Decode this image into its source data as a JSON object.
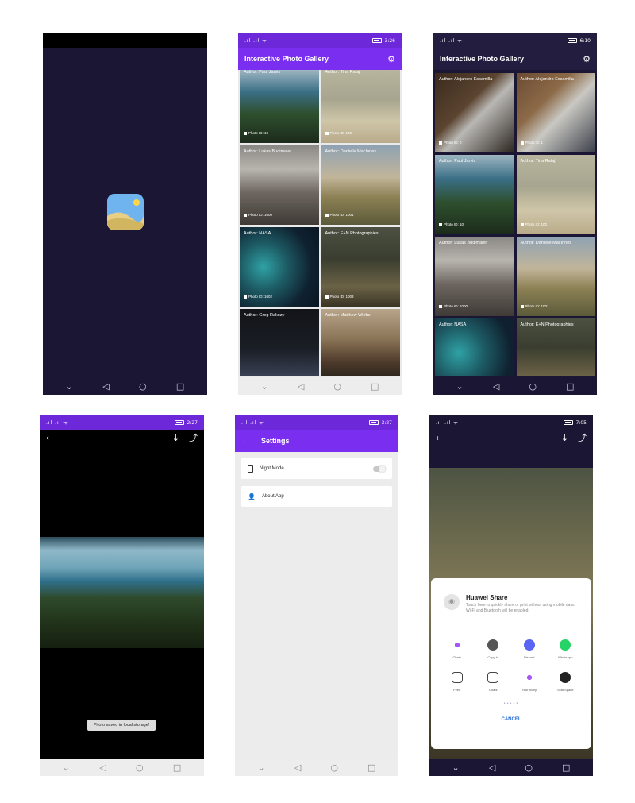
{
  "p1": {
    "label": "splash-screen"
  },
  "p2": {
    "status_time": "3:26",
    "status_left": ".ıl .ıl ᯤ",
    "title": "Interactive Photo Gallery",
    "settings_icon": "gear-icon",
    "tiles": [
      {
        "author": "Author: Paul Jarvis",
        "pid": "Photo ID: 10"
      },
      {
        "author": "Author: Tina Rataj",
        "pid": "Photo ID: 100"
      },
      {
        "author": "Author: Lukas Budimaier",
        "pid": "Photo ID: 1000"
      },
      {
        "author": "Author: Danielle MacInnes",
        "pid": "Photo ID: 1001"
      },
      {
        "author": "Author: NASA",
        "pid": "Photo ID: 1002"
      },
      {
        "author": "Author: E+N Photographies",
        "pid": "Photo ID: 1003"
      },
      {
        "author": "Author: Greg Rakozy",
        "pid": ""
      },
      {
        "author": "Author: Matthew Wiebe",
        "pid": ""
      }
    ]
  },
  "p3": {
    "status_time": "6:10",
    "status_left": ".ıl .ıl ᯤ",
    "title": "Interactive Photo Gallery",
    "tiles": [
      {
        "author": "Author: Alejandro Escamilla",
        "pid": "Photo ID: 0"
      },
      {
        "author": "Author: Alejandro Escamilla",
        "pid": "Photo ID: 1"
      },
      {
        "author": "Author: Paul Jarvis",
        "pid": "Photo ID: 10"
      },
      {
        "author": "Author: Tina Rataj",
        "pid": "Photo ID: 100"
      },
      {
        "author": "Author: Lukas Budimaier",
        "pid": "Photo ID: 1000"
      },
      {
        "author": "Author: Danielle MacInnes",
        "pid": "Photo ID: 1001"
      },
      {
        "author": "Author: NASA",
        "pid": ""
      },
      {
        "author": "Author: E+N Photographies",
        "pid": ""
      }
    ]
  },
  "p4": {
    "status_time": "2:27",
    "status_left": ".ıl .ıl ᯤ",
    "back": "←",
    "download": "↓",
    "share": "⤴",
    "toast": "Photo saved in local storage!"
  },
  "p5": {
    "status_time": "3:27",
    "status_left": ".ıl .ıl ᯤ",
    "back": "←",
    "title": "Settings",
    "night_mode": "Night Mode",
    "about": "About App"
  },
  "p6": {
    "status_time": "7:05",
    "status_left": ".ıl .ıl ᯤ",
    "back": "←",
    "download": "↓",
    "share": "⤴",
    "share_title": "Huawei Share",
    "share_desc": "Touch here to quickly share or print without using mobile data. Wi-Fi and Bluetooth will be enabled.",
    "apps": [
      "Chats",
      "Copy to",
      "Discord",
      "WhatsApp",
      "Feed",
      "Chats",
      "Your Story",
      "ScanSpace"
    ],
    "cancel": "CANCEL"
  },
  "nav": {
    "back": "◁",
    "home": "○",
    "recent": "□",
    "down": "⌄"
  },
  "colors": {
    "purple": "#6d28d9",
    "dark": "#1a1633",
    "darkbar": "#231e3f"
  }
}
